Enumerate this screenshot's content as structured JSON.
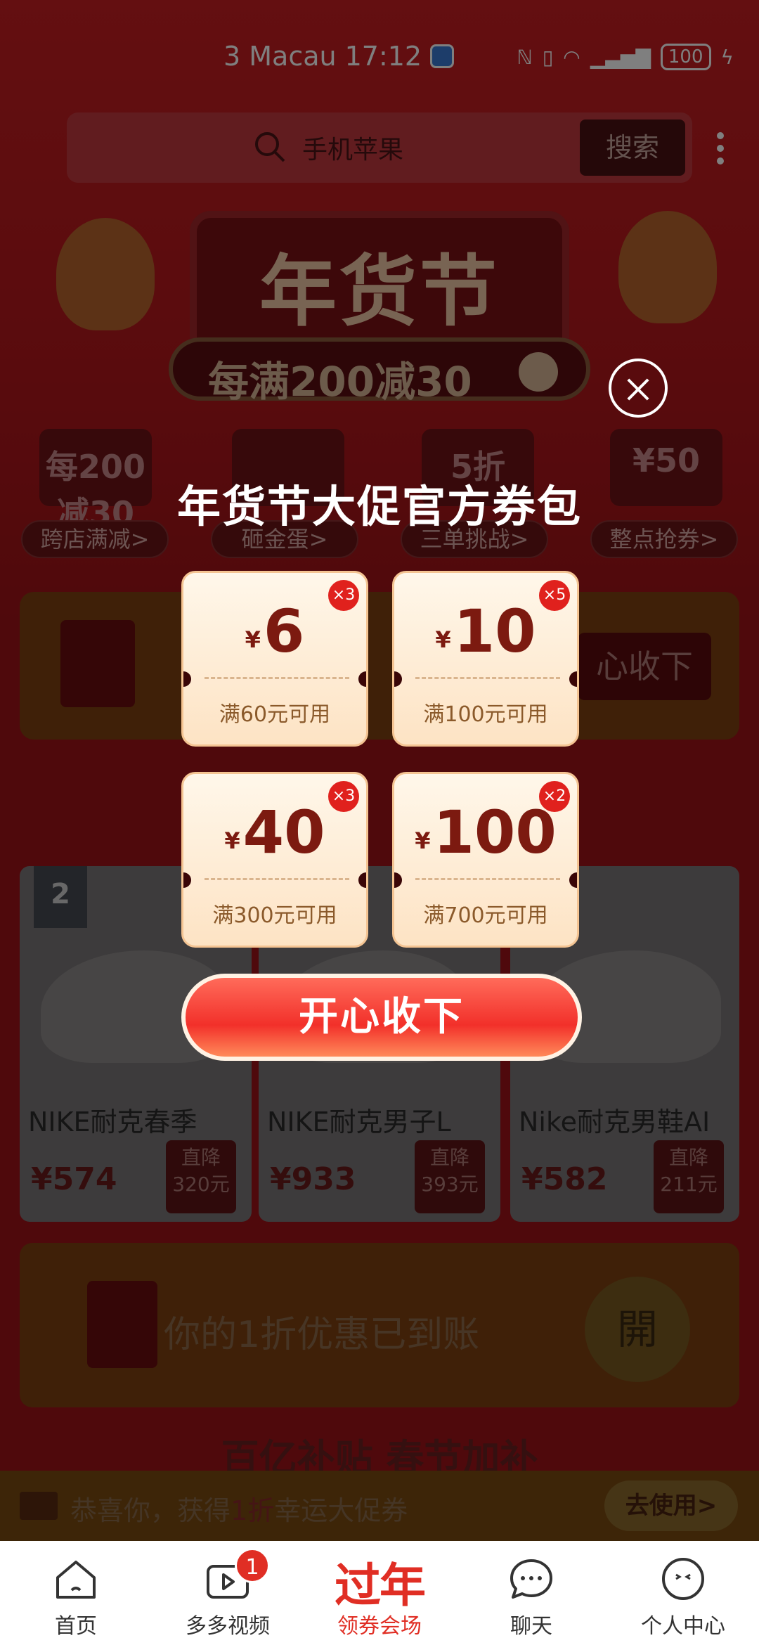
{
  "status_bar": {
    "carrier": "3 Macau",
    "time": "17:12",
    "battery": "100"
  },
  "search": {
    "placeholder": "手机苹果",
    "button": "搜索"
  },
  "banner": {
    "title": "年货节",
    "subtitle": "每满200减30"
  },
  "categories": [
    {
      "image_text": "每200减30",
      "label": "跨店满减>"
    },
    {
      "image_text": "",
      "label": "砸金蛋>"
    },
    {
      "image_text": "5折",
      "label": "三单挑战>"
    },
    {
      "image_text": "¥50",
      "label": "整点抢券>"
    }
  ],
  "red_packet_row": {
    "button": "心收下"
  },
  "products": [
    {
      "rank": "2",
      "name": "NIKE耐克春季",
      "price": "¥574",
      "drop_label": "直降",
      "drop_amount": "320元"
    },
    {
      "rank": "",
      "name": "NIKE耐克男子L",
      "price": "¥933",
      "drop_label": "直降",
      "drop_amount": "393元"
    },
    {
      "rank": "",
      "name": "Nike耐克男鞋AI",
      "price": "¥582",
      "drop_label": "直降",
      "drop_amount": "211元"
    }
  ],
  "open_card": {
    "text": "你的1折优惠已到账",
    "button": "開"
  },
  "subsidy_title": "百亿补贴 春节加补",
  "notice": {
    "prefix": "恭喜你，获得",
    "highlight": "1折",
    "suffix": "幸运大促券",
    "button": "去使用>"
  },
  "popup": {
    "title": "年货节大促官方券包",
    "coupons": [
      {
        "currency": "¥",
        "amount": "6",
        "multiplier": "×3",
        "condition": "满60元可用"
      },
      {
        "currency": "¥",
        "amount": "10",
        "multiplier": "×5",
        "condition": "满100元可用"
      },
      {
        "currency": "¥",
        "amount": "40",
        "multiplier": "×3",
        "condition": "满300元可用"
      },
      {
        "currency": "¥",
        "amount": "100",
        "multiplier": "×2",
        "condition": "满700元可用"
      }
    ],
    "cta": "开心收下"
  },
  "tabbar": [
    {
      "label": "首页",
      "icon": "home-icon"
    },
    {
      "label": "多多视频",
      "icon": "video-icon",
      "badge": "1"
    },
    {
      "label": "领券会场",
      "big": "过年",
      "icon": "festival-icon"
    },
    {
      "label": "聊天",
      "icon": "chat-icon"
    },
    {
      "label": "个人中心",
      "icon": "profile-icon"
    }
  ]
}
